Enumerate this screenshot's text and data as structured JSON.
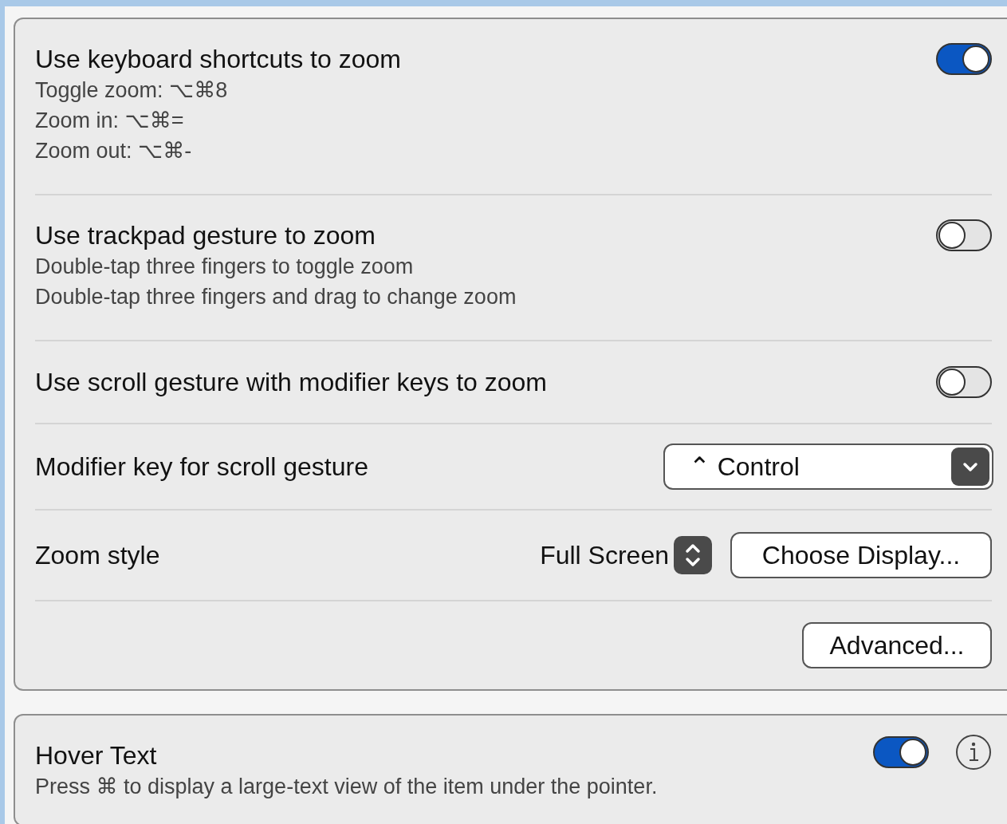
{
  "zoom_card": {
    "rows": [
      {
        "kind": "toggle",
        "title": "Use keyboard shortcuts to zoom",
        "details": [
          "Toggle zoom: ⌥⌘8",
          "Zoom in: ⌥⌘=",
          "Zoom out: ⌥⌘-"
        ],
        "on": true
      },
      {
        "kind": "toggle",
        "title": "Use trackpad gesture to zoom",
        "details": [
          "Double-tap three fingers to toggle zoom",
          "Double-tap three fingers and drag to change zoom"
        ],
        "on": false
      },
      {
        "kind": "toggle",
        "title": "Use scroll gesture with modifier keys to zoom",
        "on": false
      },
      {
        "kind": "popup",
        "title": "Modifier key for scroll gesture",
        "value": "⌃ Control"
      },
      {
        "kind": "style",
        "title": "Zoom style",
        "value": "Full Screen",
        "button": "Choose Display..."
      },
      {
        "kind": "button",
        "button": "Advanced..."
      }
    ]
  },
  "hover_card": {
    "title": "Hover Text",
    "description": "Press ⌘ to display a large-text view of the item under the pointer.",
    "on": true
  }
}
